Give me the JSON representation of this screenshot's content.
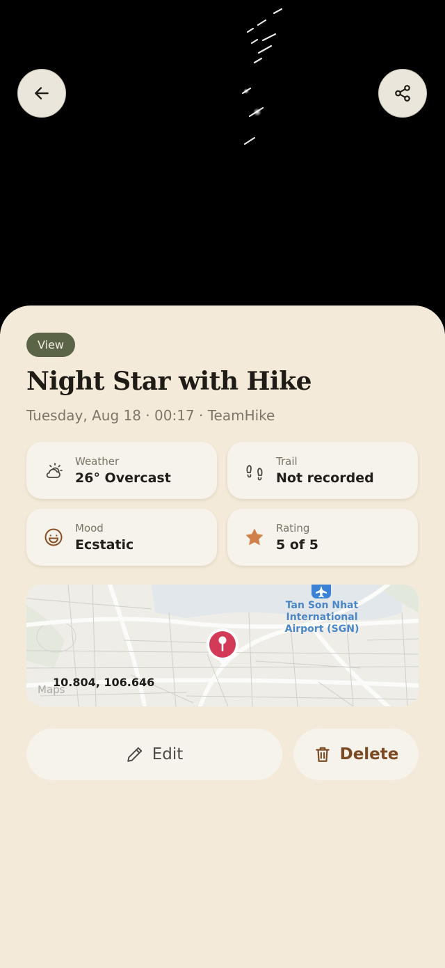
{
  "hero": {
    "image": "night-sky-star-trails"
  },
  "header": {
    "back_icon": "arrow-left-icon",
    "share_icon": "share-icon"
  },
  "entry": {
    "mode": "View",
    "title": "Night Star with Hike",
    "subtitle": "Tuesday, Aug 18 · 00:17 · TeamHike"
  },
  "stats": [
    {
      "icon": "cloud-sun-icon",
      "label": "Weather",
      "value": "26° Overcast"
    },
    {
      "icon": "footprints-icon",
      "label": "Trail",
      "value": "Not recorded"
    },
    {
      "icon": "smile-icon",
      "label": "Mood",
      "value": "Ecstatic"
    },
    {
      "icon": "star-icon",
      "label": "Rating",
      "value": "5 of 5"
    }
  ],
  "map": {
    "coordinates": "10.804, 106.646",
    "poi_label": "Tan Son Nhat International Airport (SGN)",
    "attribution": "Maps",
    "pin_color": "#d23a58"
  },
  "actions": {
    "edit_label": "Edit",
    "delete_label": "Delete"
  },
  "colors": {
    "background": "#f3ead9",
    "chip": "#5b6446",
    "accent_star": "#d0804a",
    "delete": "#7b4a22"
  }
}
